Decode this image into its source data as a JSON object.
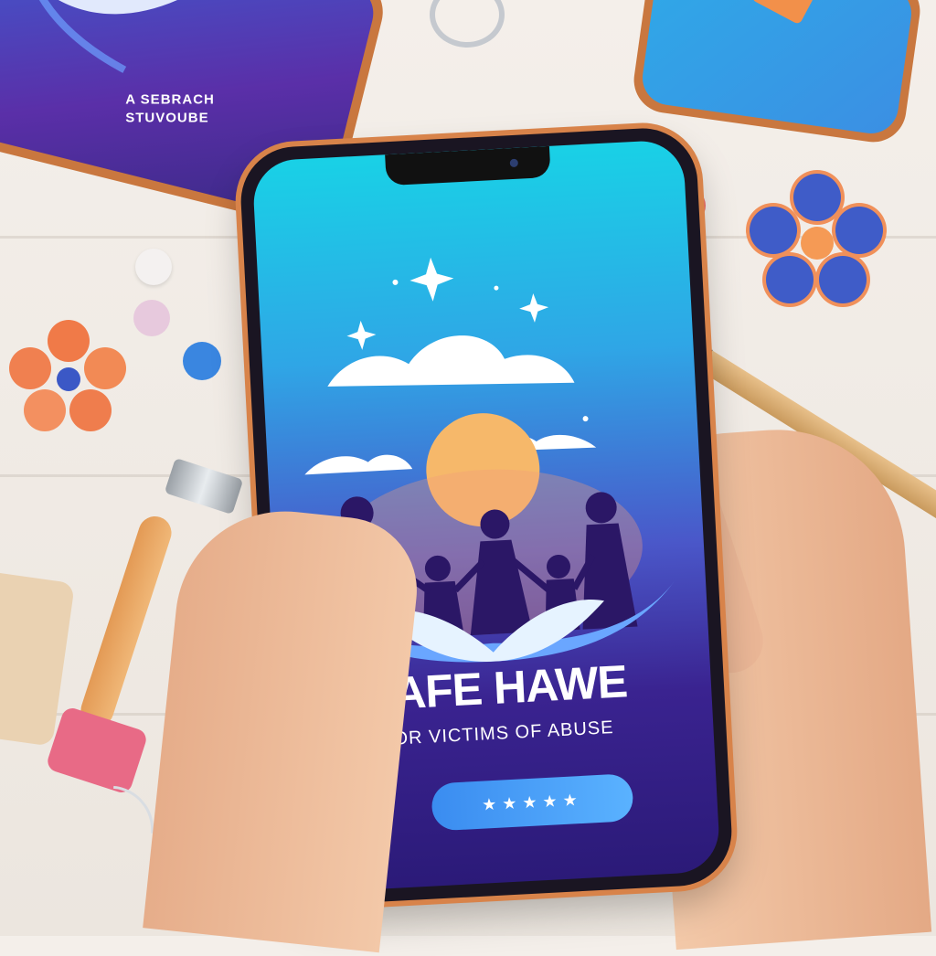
{
  "background_phone_left": {
    "label_line1": "A SEBRACH",
    "label_line2": "STUVOUBE"
  },
  "app": {
    "title": "SAFE HAWE",
    "subtitle": "FOR VICTIMS OF ABUSE",
    "cta_label": "★★★★★"
  },
  "colors": {
    "screen_top": "#19d1e6",
    "screen_bottom": "#2b1a78",
    "sun": "#f6b86a",
    "button": "#4aa3ff",
    "frame": "#d8834a"
  }
}
